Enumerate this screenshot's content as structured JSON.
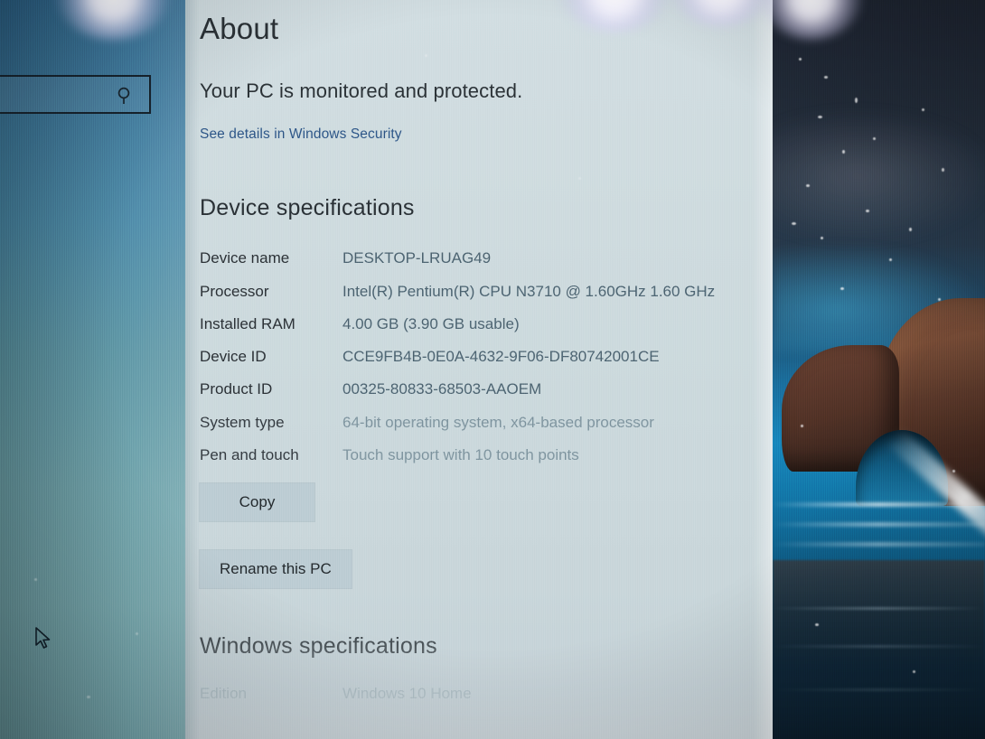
{
  "page": {
    "title": "About",
    "subtitle": "Your PC is monitored and protected.",
    "security_link": "See details in Windows Security"
  },
  "device_specifications": {
    "heading": "Device specifications",
    "rows": [
      {
        "label": "Device name",
        "value": "DESKTOP-LRUAG49"
      },
      {
        "label": "Processor",
        "value": "Intel(R) Pentium(R) CPU  N3710  @ 1.60GHz  1.60 GHz"
      },
      {
        "label": "Installed RAM",
        "value": "4.00 GB (3.90 GB usable)"
      },
      {
        "label": "Device ID",
        "value": "CCE9FB4B-0E0A-4632-9F06-DF80742001CE"
      },
      {
        "label": "Product ID",
        "value": "00325-80833-68503-AAOEM"
      },
      {
        "label": "System type",
        "value": "64-bit operating system, x64-based processor"
      },
      {
        "label": "Pen and touch",
        "value": "Touch support with 10 touch points"
      }
    ],
    "copy_button": "Copy",
    "rename_button": "Rename this PC"
  },
  "windows_specifications": {
    "heading": "Windows specifications",
    "rows": [
      {
        "label": "Edition",
        "value": "Windows 10 Home"
      }
    ]
  },
  "desktop": {
    "search_placeholder": "",
    "search_icon": "search-icon",
    "cursor_icon": "mouse-pointer-icon"
  },
  "colors": {
    "panel_background": "#ccd9dd",
    "heading_text": "#2a3136",
    "label_text": "#2b3136",
    "value_text": "#4d6472",
    "value_text_dim": "#7f95a0",
    "link": "#2d5688",
    "button_background": "#bdcdd4",
    "wallpaper_sea": "#1787bd",
    "wallpaper_rock": "#6b4433"
  }
}
